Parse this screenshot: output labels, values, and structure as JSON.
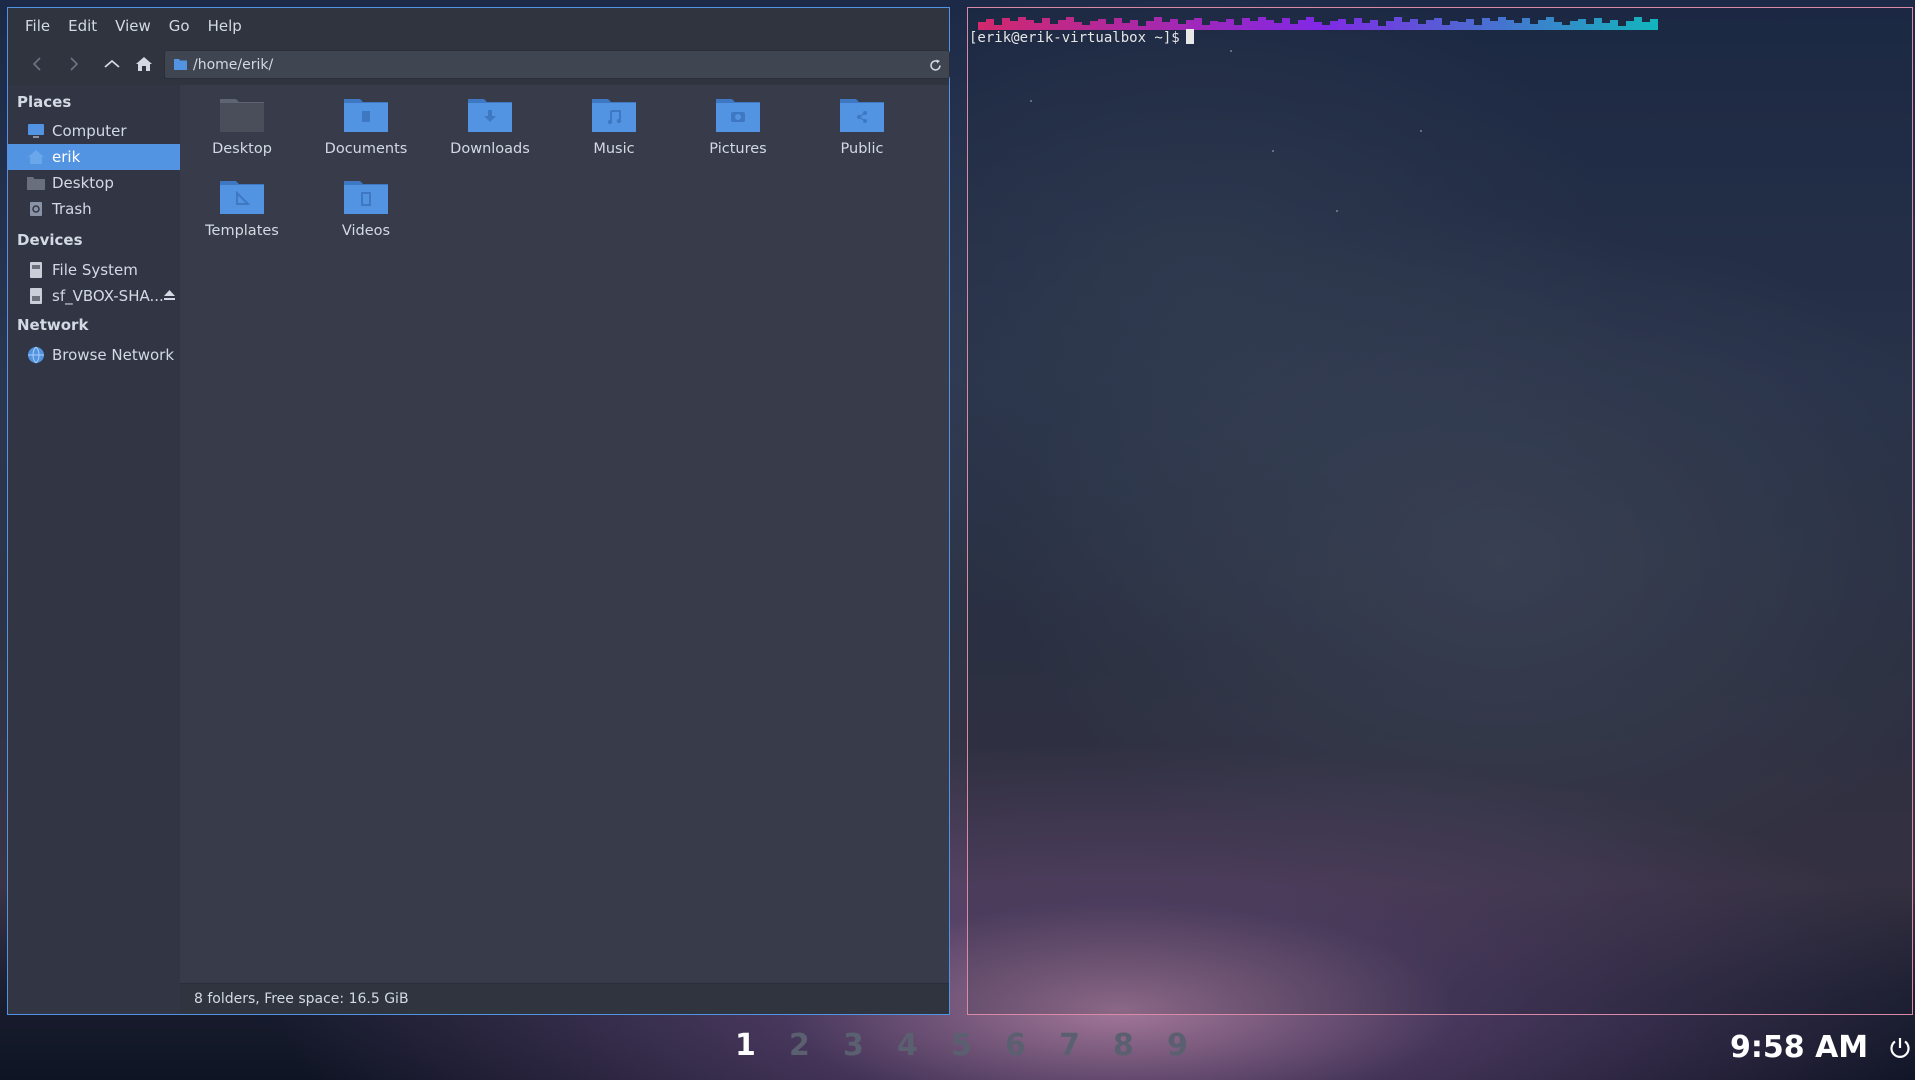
{
  "file_manager": {
    "menu": [
      "File",
      "Edit",
      "View",
      "Go",
      "Help"
    ],
    "address": "/home/erik/",
    "sidebar": {
      "places_header": "Places",
      "places": [
        {
          "label": "Computer",
          "icon": "computer-icon"
        },
        {
          "label": "erik",
          "icon": "home-icon",
          "selected": true
        },
        {
          "label": "Desktop",
          "icon": "desktop-folder-icon"
        },
        {
          "label": "Trash",
          "icon": "trash-icon"
        }
      ],
      "devices_header": "Devices",
      "devices": [
        {
          "label": "File System",
          "icon": "drive-icon"
        },
        {
          "label": "sf_VBOX-SHA...",
          "icon": "drive-icon"
        }
      ],
      "network_header": "Network",
      "network": [
        {
          "label": "Browse Network",
          "icon": "network-icon"
        }
      ]
    },
    "folders": [
      {
        "name": "Desktop",
        "icon": "desktop-folder-icon"
      },
      {
        "name": "Documents",
        "icon": "documents-folder-icon"
      },
      {
        "name": "Downloads",
        "icon": "downloads-folder-icon"
      },
      {
        "name": "Music",
        "icon": "music-folder-icon"
      },
      {
        "name": "Pictures",
        "icon": "pictures-folder-icon"
      },
      {
        "name": "Public",
        "icon": "public-folder-icon"
      },
      {
        "name": "Templates",
        "icon": "templates-folder-icon"
      },
      {
        "name": "Videos",
        "icon": "videos-folder-icon"
      }
    ],
    "status": "8 folders, Free space: 16.5 GiB"
  },
  "terminal": {
    "prompt": "[erik@erik-virtualbox ~]$"
  },
  "taskbar": {
    "workspaces": [
      "1",
      "2",
      "3",
      "4",
      "5",
      "6",
      "7",
      "8",
      "9"
    ],
    "active_workspace": "1",
    "clock": "9:58 AM"
  },
  "colors": {
    "accent": "#5294e2",
    "window_bg": "#383c4a",
    "folder_blue": "#5294e2",
    "terminal_border": "#d98aa6"
  }
}
